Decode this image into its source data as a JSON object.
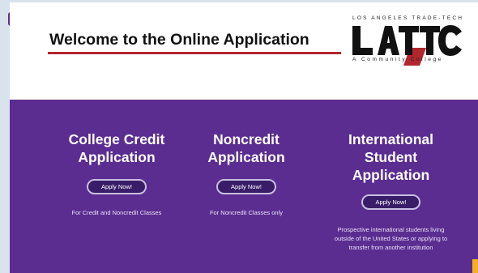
{
  "header": {
    "title": "Welcome to the Online Application",
    "logo": {
      "top_text": "LOS ANGELES TRADE-TECH",
      "wordmark": "LATTC",
      "bottom_text": "A Community College"
    }
  },
  "menu": {
    "icon": "hamburger-menu-icon"
  },
  "applications": [
    {
      "title_line1": "College Credit",
      "title_line2": "Application",
      "button": "Apply Now!",
      "description": "For Credit and Noncredit Classes"
    },
    {
      "title_line1": "Noncredit",
      "title_line2": "Application",
      "button": "Apply Now!",
      "description": "For Noncredit Classes only"
    },
    {
      "title_line1": "International",
      "title_line2": "Student",
      "title_line3": "Application",
      "button": "Apply Now!",
      "description_line1": "Prospective international students living",
      "description_line2": "outside of the United States or applying to",
      "description_line3": "transfer from another institution"
    }
  ],
  "colors": {
    "brand_purple": "#5b2d91",
    "accent_red": "#b3262e",
    "corner_tab": "#f5b021"
  }
}
